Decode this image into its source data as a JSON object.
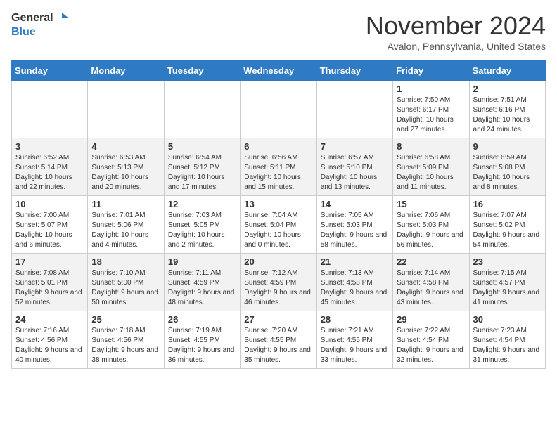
{
  "header": {
    "logo_line1": "General",
    "logo_line2": "Blue",
    "month": "November 2024",
    "location": "Avalon, Pennsylvania, United States"
  },
  "weekdays": [
    "Sunday",
    "Monday",
    "Tuesday",
    "Wednesday",
    "Thursday",
    "Friday",
    "Saturday"
  ],
  "weeks": [
    [
      {
        "day": "",
        "info": ""
      },
      {
        "day": "",
        "info": ""
      },
      {
        "day": "",
        "info": ""
      },
      {
        "day": "",
        "info": ""
      },
      {
        "day": "",
        "info": ""
      },
      {
        "day": "1",
        "info": "Sunrise: 7:50 AM\nSunset: 6:17 PM\nDaylight: 10 hours\nand 27 minutes."
      },
      {
        "day": "2",
        "info": "Sunrise: 7:51 AM\nSunset: 6:16 PM\nDaylight: 10 hours\nand 24 minutes."
      }
    ],
    [
      {
        "day": "3",
        "info": "Sunrise: 6:52 AM\nSunset: 5:14 PM\nDaylight: 10 hours\nand 22 minutes."
      },
      {
        "day": "4",
        "info": "Sunrise: 6:53 AM\nSunset: 5:13 PM\nDaylight: 10 hours\nand 20 minutes."
      },
      {
        "day": "5",
        "info": "Sunrise: 6:54 AM\nSunset: 5:12 PM\nDaylight: 10 hours\nand 17 minutes."
      },
      {
        "day": "6",
        "info": "Sunrise: 6:56 AM\nSunset: 5:11 PM\nDaylight: 10 hours\nand 15 minutes."
      },
      {
        "day": "7",
        "info": "Sunrise: 6:57 AM\nSunset: 5:10 PM\nDaylight: 10 hours\nand 13 minutes."
      },
      {
        "day": "8",
        "info": "Sunrise: 6:58 AM\nSunset: 5:09 PM\nDaylight: 10 hours\nand 11 minutes."
      },
      {
        "day": "9",
        "info": "Sunrise: 6:59 AM\nSunset: 5:08 PM\nDaylight: 10 hours\nand 8 minutes."
      }
    ],
    [
      {
        "day": "10",
        "info": "Sunrise: 7:00 AM\nSunset: 5:07 PM\nDaylight: 10 hours\nand 6 minutes."
      },
      {
        "day": "11",
        "info": "Sunrise: 7:01 AM\nSunset: 5:06 PM\nDaylight: 10 hours\nand 4 minutes."
      },
      {
        "day": "12",
        "info": "Sunrise: 7:03 AM\nSunset: 5:05 PM\nDaylight: 10 hours\nand 2 minutes."
      },
      {
        "day": "13",
        "info": "Sunrise: 7:04 AM\nSunset: 5:04 PM\nDaylight: 10 hours\nand 0 minutes."
      },
      {
        "day": "14",
        "info": "Sunrise: 7:05 AM\nSunset: 5:03 PM\nDaylight: 9 hours\nand 58 minutes."
      },
      {
        "day": "15",
        "info": "Sunrise: 7:06 AM\nSunset: 5:03 PM\nDaylight: 9 hours\nand 56 minutes."
      },
      {
        "day": "16",
        "info": "Sunrise: 7:07 AM\nSunset: 5:02 PM\nDaylight: 9 hours\nand 54 minutes."
      }
    ],
    [
      {
        "day": "17",
        "info": "Sunrise: 7:08 AM\nSunset: 5:01 PM\nDaylight: 9 hours\nand 52 minutes."
      },
      {
        "day": "18",
        "info": "Sunrise: 7:10 AM\nSunset: 5:00 PM\nDaylight: 9 hours\nand 50 minutes."
      },
      {
        "day": "19",
        "info": "Sunrise: 7:11 AM\nSunset: 4:59 PM\nDaylight: 9 hours\nand 48 minutes."
      },
      {
        "day": "20",
        "info": "Sunrise: 7:12 AM\nSunset: 4:59 PM\nDaylight: 9 hours\nand 46 minutes."
      },
      {
        "day": "21",
        "info": "Sunrise: 7:13 AM\nSunset: 4:58 PM\nDaylight: 9 hours\nand 45 minutes."
      },
      {
        "day": "22",
        "info": "Sunrise: 7:14 AM\nSunset: 4:58 PM\nDaylight: 9 hours\nand 43 minutes."
      },
      {
        "day": "23",
        "info": "Sunrise: 7:15 AM\nSunset: 4:57 PM\nDaylight: 9 hours\nand 41 minutes."
      }
    ],
    [
      {
        "day": "24",
        "info": "Sunrise: 7:16 AM\nSunset: 4:56 PM\nDaylight: 9 hours\nand 40 minutes."
      },
      {
        "day": "25",
        "info": "Sunrise: 7:18 AM\nSunset: 4:56 PM\nDaylight: 9 hours\nand 38 minutes."
      },
      {
        "day": "26",
        "info": "Sunrise: 7:19 AM\nSunset: 4:55 PM\nDaylight: 9 hours\nand 36 minutes."
      },
      {
        "day": "27",
        "info": "Sunrise: 7:20 AM\nSunset: 4:55 PM\nDaylight: 9 hours\nand 35 minutes."
      },
      {
        "day": "28",
        "info": "Sunrise: 7:21 AM\nSunset: 4:55 PM\nDaylight: 9 hours\nand 33 minutes."
      },
      {
        "day": "29",
        "info": "Sunrise: 7:22 AM\nSunset: 4:54 PM\nDaylight: 9 hours\nand 32 minutes."
      },
      {
        "day": "30",
        "info": "Sunrise: 7:23 AM\nSunset: 4:54 PM\nDaylight: 9 hours\nand 31 minutes."
      }
    ]
  ]
}
